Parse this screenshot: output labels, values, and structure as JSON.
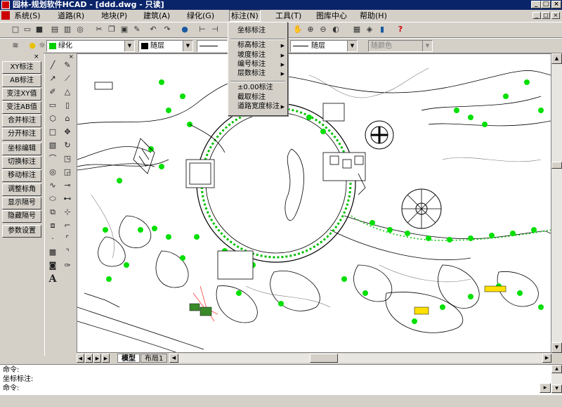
{
  "window": {
    "title": "园林-规划软件HCAD - [ddd.dwg - 只读]",
    "minimize": "_",
    "restore": "□",
    "close": "×"
  },
  "menu": {
    "items": [
      "系统(S)",
      "道路(R)",
      "地块(P)",
      "建筑(A)",
      "绿化(G)",
      "标注(N)",
      "工具(T)",
      "图库中心",
      "帮助(H)"
    ],
    "active_index": 5
  },
  "annotate_menu": {
    "items": [
      {
        "label": "坐标标注",
        "submenu": false
      },
      {
        "label": "标高标注",
        "submenu": true
      },
      {
        "label": "坡度标注",
        "submenu": true
      },
      {
        "label": "编号标注",
        "submenu": true
      },
      {
        "label": "层数标注",
        "submenu": true
      },
      {
        "label": "±0.00标注",
        "submenu": false
      },
      {
        "label": "截取标注",
        "submenu": false
      },
      {
        "label": "道路宽度标注",
        "submenu": true
      }
    ]
  },
  "layers_toolbar": {
    "layer": "绿化",
    "color": "随层",
    "linetype": "随层",
    "lineweight": "随颜色"
  },
  "left_panel": {
    "buttons": [
      "XY标注",
      "AB标注",
      "变注XY值",
      "变注AB值",
      "合并标注",
      "分开标注",
      "坐标编辑",
      "切换标注",
      "移动标注",
      "调整标角",
      "显示隔号",
      "隐藏隔号",
      "参数设置"
    ]
  },
  "layout_tabs": [
    "模型",
    "布局1"
  ],
  "command_lines": [
    "命令:",
    "坐标标注:",
    "命令:"
  ],
  "icons": {
    "standard": [
      "new-icon",
      "open-icon",
      "save-icon",
      "print-icon",
      "preview-icon",
      "find-icon",
      "cut-icon",
      "copy-icon",
      "paste-icon",
      "match-icon",
      "undo-icon",
      "redo-icon",
      "web-icon"
    ],
    "draw": [
      "line-icon",
      "pencil-icon",
      "ray-icon",
      "polyline-icon",
      "pen-icon",
      "triangle-icon",
      "rect-icon",
      "rect2-icon",
      "polygon-icon",
      "house-icon",
      "square-icon",
      "move-icon",
      "hatch-icon",
      "rotate-icon",
      "arc-icon",
      "scale-icon",
      "circle-icon",
      "stretch-icon",
      "spline-icon",
      "trim-icon",
      "ellipse-icon",
      "extend-icon",
      "insert-icon",
      "break-icon",
      "block-icon",
      "chamfer-icon",
      "point-icon",
      "fillet-icon",
      "hatch2-icon",
      "explode-icon",
      "region-icon",
      "text-icon",
      "mtext-icon"
    ]
  },
  "colors": {
    "titlebar": "#0a246a",
    "face": "#d4d0c8",
    "green": "#00d000",
    "drawing": "#000000"
  }
}
